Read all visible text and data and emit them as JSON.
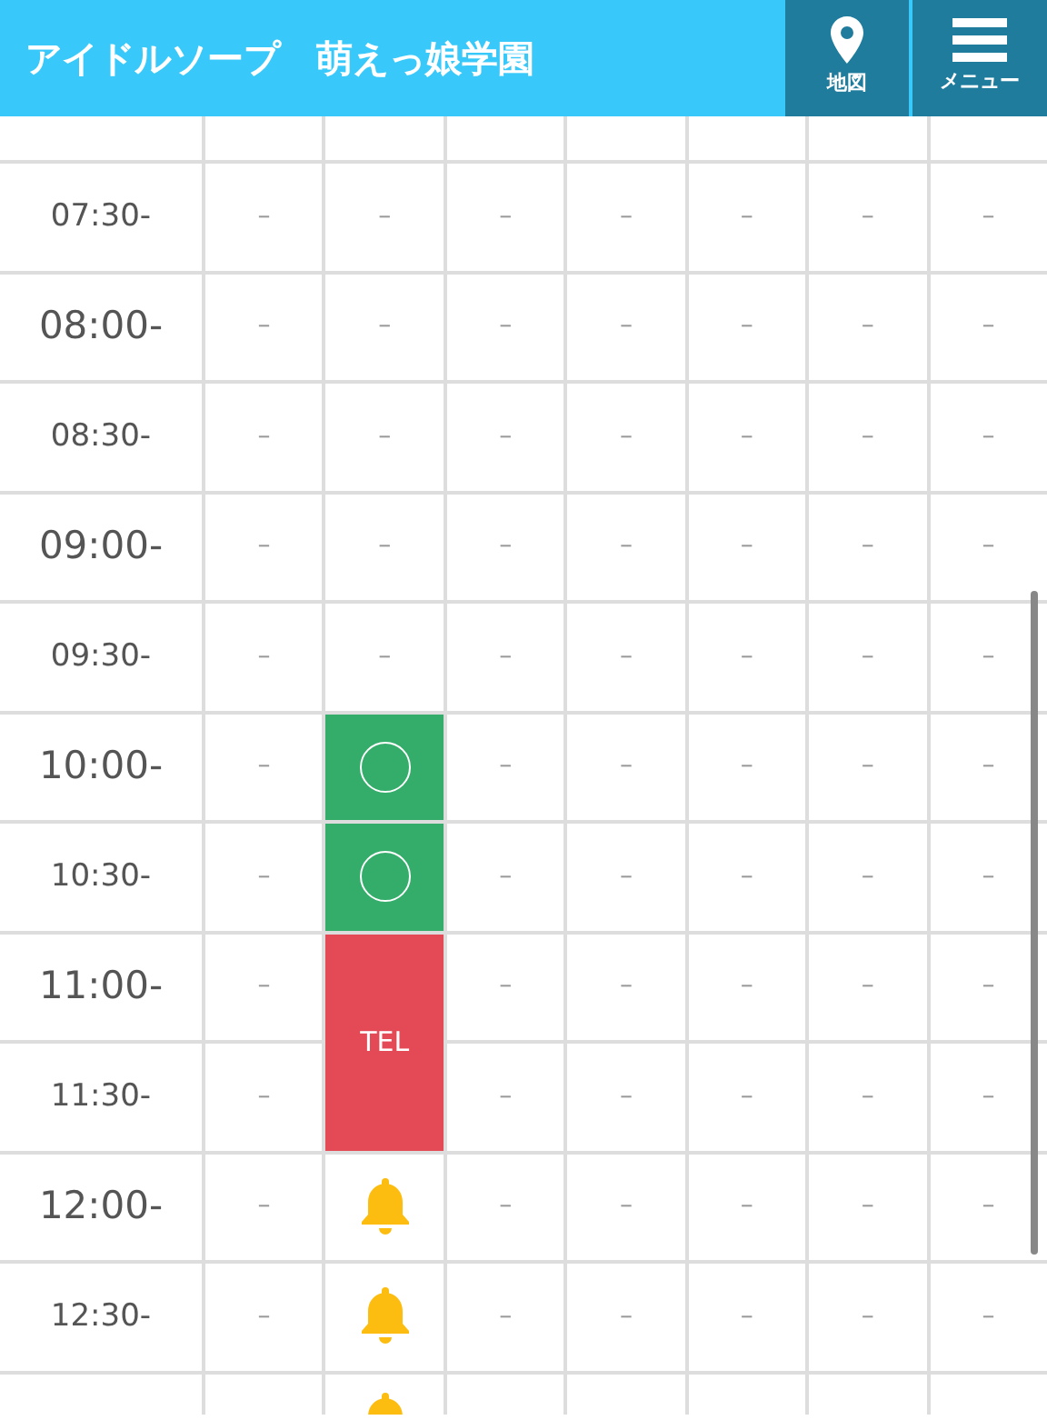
{
  "header": {
    "title": "アイドルソープ　萌えっ娘学園",
    "buttons": [
      {
        "kind": "map",
        "label": "地図"
      },
      {
        "kind": "menu",
        "label": "メニュー"
      }
    ]
  },
  "schedule": {
    "rows": [
      {
        "cells": [
          {
            "kind": "blank"
          },
          {
            "kind": "blank"
          },
          {
            "kind": "blank"
          },
          {
            "kind": "blank"
          },
          {
            "kind": "blank"
          },
          {
            "kind": "blank"
          },
          {
            "kind": "blank"
          }
        ]
      },
      {
        "time": "07:30-",
        "major": false,
        "cells": [
          {
            "kind": "dash",
            "text": "–"
          },
          {
            "kind": "dash",
            "text": "–"
          },
          {
            "kind": "dash",
            "text": "–"
          },
          {
            "kind": "dash",
            "text": "–"
          },
          {
            "kind": "dash",
            "text": "–"
          },
          {
            "kind": "dash",
            "text": "–"
          },
          {
            "kind": "dash",
            "text": "–"
          }
        ]
      },
      {
        "time": "08:00-",
        "major": true,
        "cells": [
          {
            "kind": "dash",
            "text": "–"
          },
          {
            "kind": "dash",
            "text": "–"
          },
          {
            "kind": "dash",
            "text": "–"
          },
          {
            "kind": "dash",
            "text": "–"
          },
          {
            "kind": "dash",
            "text": "–"
          },
          {
            "kind": "dash",
            "text": "–"
          },
          {
            "kind": "dash",
            "text": "–"
          }
        ]
      },
      {
        "time": "08:30-",
        "major": false,
        "cells": [
          {
            "kind": "dash",
            "text": "–"
          },
          {
            "kind": "dash",
            "text": "–"
          },
          {
            "kind": "dash",
            "text": "–"
          },
          {
            "kind": "dash",
            "text": "–"
          },
          {
            "kind": "dash",
            "text": "–"
          },
          {
            "kind": "dash",
            "text": "–"
          },
          {
            "kind": "dash",
            "text": "–"
          }
        ]
      },
      {
        "time": "09:00-",
        "major": true,
        "cells": [
          {
            "kind": "dash",
            "text": "–"
          },
          {
            "kind": "dash",
            "text": "–"
          },
          {
            "kind": "dash",
            "text": "–"
          },
          {
            "kind": "dash",
            "text": "–"
          },
          {
            "kind": "dash",
            "text": "–"
          },
          {
            "kind": "dash",
            "text": "–"
          },
          {
            "kind": "dash",
            "text": "–"
          }
        ]
      },
      {
        "time": "09:30-",
        "major": false,
        "cells": [
          {
            "kind": "dash",
            "text": "–"
          },
          {
            "kind": "dash",
            "text": "–"
          },
          {
            "kind": "dash",
            "text": "–"
          },
          {
            "kind": "dash",
            "text": "–"
          },
          {
            "kind": "dash",
            "text": "–"
          },
          {
            "kind": "dash",
            "text": "–"
          },
          {
            "kind": "dash",
            "text": "–"
          }
        ]
      },
      {
        "time": "10:00-",
        "major": true,
        "cells": [
          {
            "kind": "dash",
            "text": "–"
          },
          {
            "kind": "available"
          },
          {
            "kind": "dash",
            "text": "–"
          },
          {
            "kind": "dash",
            "text": "–"
          },
          {
            "kind": "dash",
            "text": "–"
          },
          {
            "kind": "dash",
            "text": "–"
          },
          {
            "kind": "dash",
            "text": "–"
          }
        ]
      },
      {
        "time": "10:30-",
        "major": false,
        "cells": [
          {
            "kind": "dash",
            "text": "–"
          },
          {
            "kind": "available"
          },
          {
            "kind": "dash",
            "text": "–"
          },
          {
            "kind": "dash",
            "text": "–"
          },
          {
            "kind": "dash",
            "text": "–"
          },
          {
            "kind": "dash",
            "text": "–"
          },
          {
            "kind": "dash",
            "text": "–"
          }
        ]
      },
      {
        "time": "11:00-",
        "major": true,
        "cells": [
          {
            "kind": "dash",
            "text": "–"
          },
          {
            "kind": "tel",
            "text": "TEL"
          },
          {
            "kind": "dash",
            "text": "–"
          },
          {
            "kind": "dash",
            "text": "–"
          },
          {
            "kind": "dash",
            "text": "–"
          },
          {
            "kind": "dash",
            "text": "–"
          },
          {
            "kind": "dash",
            "text": "–"
          }
        ]
      },
      {
        "time": "11:30-",
        "major": false,
        "cells": [
          {
            "kind": "dash",
            "text": "–"
          },
          {
            "kind": "continued"
          },
          {
            "kind": "dash",
            "text": "–"
          },
          {
            "kind": "dash",
            "text": "–"
          },
          {
            "kind": "dash",
            "text": "–"
          },
          {
            "kind": "dash",
            "text": "–"
          },
          {
            "kind": "dash",
            "text": "–"
          }
        ]
      },
      {
        "time": "12:00-",
        "major": true,
        "cells": [
          {
            "kind": "dash",
            "text": "–"
          },
          {
            "kind": "bell"
          },
          {
            "kind": "dash",
            "text": "–"
          },
          {
            "kind": "dash",
            "text": "–"
          },
          {
            "kind": "dash",
            "text": "–"
          },
          {
            "kind": "dash",
            "text": "–"
          },
          {
            "kind": "dash",
            "text": "–"
          }
        ]
      },
      {
        "time": "12:30-",
        "major": false,
        "cells": [
          {
            "kind": "dash",
            "text": "–"
          },
          {
            "kind": "bell"
          },
          {
            "kind": "dash",
            "text": "–"
          },
          {
            "kind": "dash",
            "text": "–"
          },
          {
            "kind": "dash",
            "text": "–"
          },
          {
            "kind": "dash",
            "text": "–"
          },
          {
            "kind": "dash",
            "text": "–"
          }
        ]
      },
      {
        "cells": [
          {
            "kind": "blank"
          },
          {
            "kind": "bell"
          },
          {
            "kind": "blank"
          },
          {
            "kind": "blank"
          },
          {
            "kind": "blank"
          },
          {
            "kind": "blank"
          },
          {
            "kind": "blank"
          }
        ]
      }
    ]
  }
}
